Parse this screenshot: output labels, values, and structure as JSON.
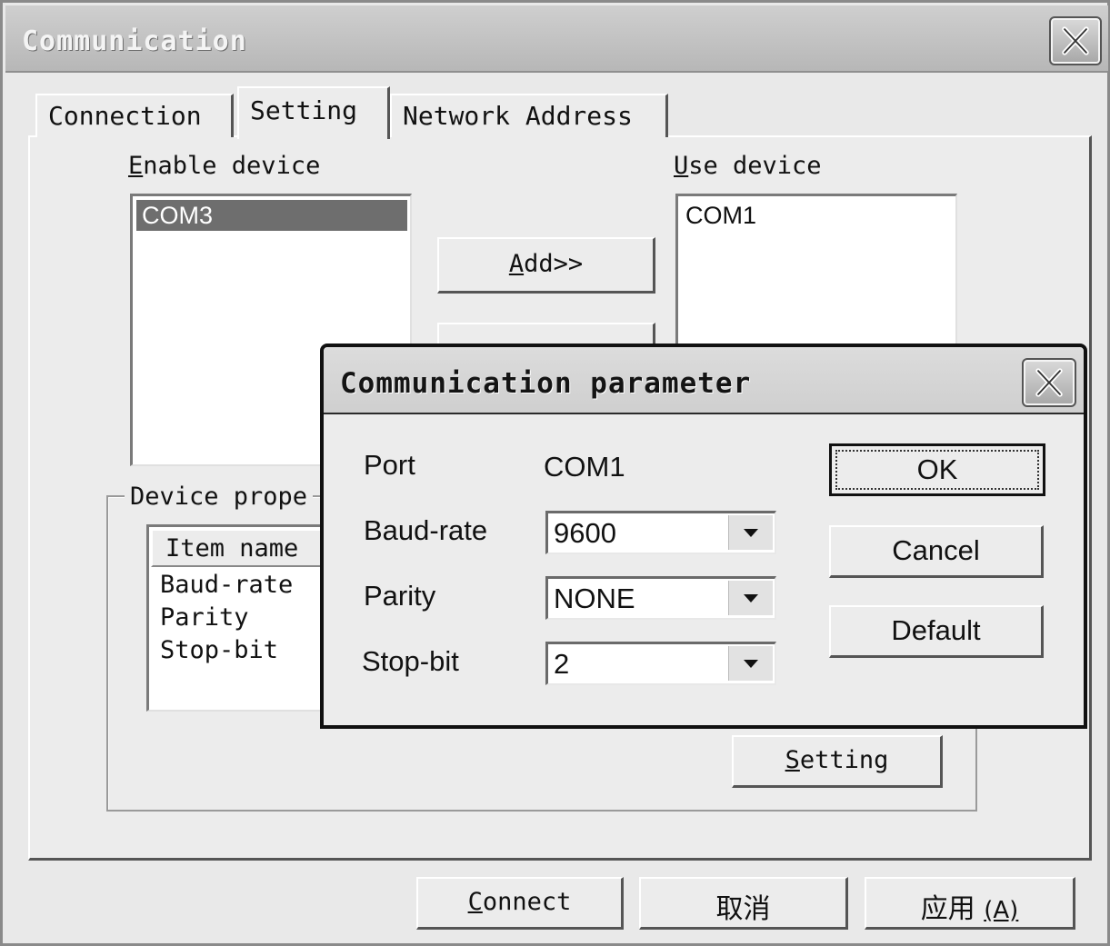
{
  "window": {
    "title": "Communication"
  },
  "tabs": [
    {
      "label": "Connection"
    },
    {
      "label": "Setting"
    },
    {
      "label": "Network Address"
    }
  ],
  "setting": {
    "enable_device_label_accel": "E",
    "enable_device_label_rest": "nable device",
    "enable_devices": [
      "COM3"
    ],
    "add_button_accel": "A",
    "add_button_rest": "dd>>",
    "use_device_label_accel": "U",
    "use_device_label_rest": "se device",
    "use_devices": [
      "COM1"
    ],
    "device_properties_label": "Device prope",
    "props_header": "Item name",
    "props_items": [
      "Baud-rate",
      "Parity",
      "Stop-bit"
    ],
    "setting_button_accel": "S",
    "setting_button_rest": "etting"
  },
  "bottom_buttons": {
    "connect_accel": "C",
    "connect_rest": "onnect",
    "cancel": "取消",
    "apply": "应用",
    "apply_accel_paren": "(A)"
  },
  "dialog": {
    "title": "Communication parameter",
    "port_label": "Port",
    "port_value": "COM1",
    "baud_label": "Baud-rate",
    "baud_value": "9600",
    "parity_label": "Parity",
    "parity_value": "NONE",
    "stop_label": "Stop-bit",
    "stop_value": "2",
    "ok": "OK",
    "cancel": "Cancel",
    "default": "Default"
  },
  "colors": {
    "selection": "#6e6e6e",
    "titlebar": "#bdbdbd",
    "face": "#ececec"
  }
}
